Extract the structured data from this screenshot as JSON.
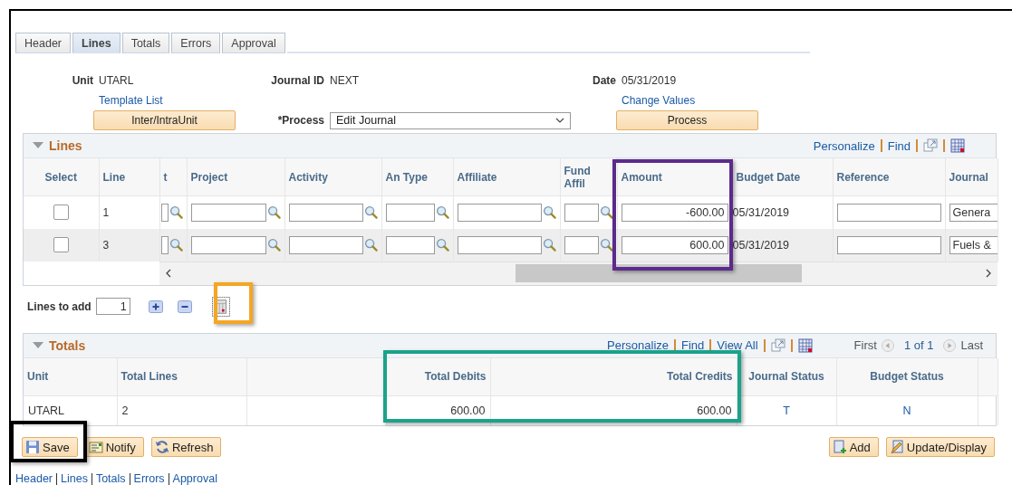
{
  "tabs": [
    {
      "label": "Header",
      "selected": false
    },
    {
      "label": "Lines",
      "selected": true
    },
    {
      "label": "Totals",
      "selected": false
    },
    {
      "label": "Errors",
      "selected": false
    },
    {
      "label": "Approval",
      "selected": false
    }
  ],
  "header": {
    "unit_label": "Unit",
    "unit": "UTARL",
    "journal_id_label": "Journal ID",
    "journal_id": "NEXT",
    "date_label": "Date",
    "date": "05/31/2019",
    "template_link": "Template List",
    "change_values_link": "Change Values",
    "inter_button": "Inter/IntraUnit",
    "process_label": "*Process",
    "process_value": "Edit Journal",
    "process_button": "Process"
  },
  "lines_grid": {
    "title": "Lines",
    "expanded": true,
    "links": [
      "Personalize",
      "Find"
    ],
    "columns": [
      {
        "label": "Select",
        "kind": "select"
      },
      {
        "label": "Line",
        "kind": "line"
      },
      {
        "label": "t",
        "kind": "lookup"
      },
      {
        "label": "Project",
        "kind": "lookup"
      },
      {
        "label": "Activity",
        "kind": "lookup"
      },
      {
        "label": "An Type",
        "kind": "lookup"
      },
      {
        "label": "Affiliate",
        "kind": "lookup"
      },
      {
        "label": "Fund Affil",
        "kind": "lookup"
      },
      {
        "label": "Amount",
        "kind": "amount"
      },
      {
        "label": "Budget Date",
        "kind": "date"
      },
      {
        "label": "Reference",
        "kind": "input"
      },
      {
        "label": "Journal",
        "kind": "journal"
      }
    ],
    "rows": [
      {
        "checked": false,
        "line": "1",
        "amount": "-600.00",
        "budget_date": "05/31/2019",
        "journal": "Genera"
      },
      {
        "checked": false,
        "line": "3",
        "amount": "600.00",
        "budget_date": "05/31/2019",
        "journal": "Fuels &"
      }
    ]
  },
  "lines_to_add": {
    "label": "Lines to add",
    "value": "1"
  },
  "totals_grid": {
    "title": "Totals",
    "expanded": true,
    "links": [
      "Personalize",
      "Find",
      "View All"
    ],
    "nav": {
      "first": "First",
      "count": "1 of 1",
      "last": "Last"
    },
    "columns": [
      {
        "label": "Unit",
        "kind": "unit"
      },
      {
        "label": "Total Lines",
        "kind": "count"
      },
      {
        "kind": "blank"
      },
      {
        "label": "Total Debits",
        "kind": "debits"
      },
      {
        "label": "Total Credits",
        "kind": "credits"
      },
      {
        "label": "Journal Status",
        "kind": "journal_status"
      },
      {
        "label": "Budget Status",
        "kind": "budget_status"
      },
      {
        "kind": "blank"
      }
    ],
    "rows": [
      {
        "unit": "UTARL",
        "total_lines": "2",
        "total_debits": "600.00",
        "total_credits": "600.00",
        "journal_status": "T",
        "budget_status": "N"
      }
    ]
  },
  "buttons": [
    {
      "label": "Save",
      "kind": "save"
    },
    {
      "label": "Notify",
      "kind": "notify"
    },
    {
      "label": "Refresh",
      "kind": "refresh"
    }
  ],
  "actions": [
    {
      "label": "Add",
      "kind": "add"
    },
    {
      "label": "Update/Display",
      "kind": "update"
    }
  ],
  "footer_links": [
    "Header",
    "Lines",
    "Totals",
    "Errors",
    "Approval"
  ],
  "highlights": [
    {
      "color": "#5c2a8c"
    },
    {
      "color": "#f5a623"
    },
    {
      "color": "#1aa38a"
    },
    {
      "color": "#000000"
    }
  ]
}
